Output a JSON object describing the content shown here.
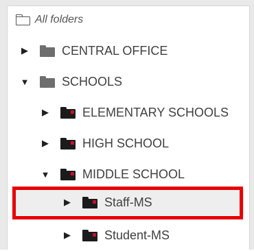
{
  "tree": {
    "root": {
      "label": "All folders",
      "icon": "folder-outline-icon"
    },
    "items": [
      {
        "label": "CENTRAL OFFICE",
        "caret": "▶",
        "icon": "folder-icon"
      },
      {
        "label": "SCHOOLS",
        "caret": "▼",
        "icon": "folder-icon"
      },
      {
        "label": "ELEMENTARY SCHOOLS",
        "caret": "▶",
        "icon": "folder-shared-icon"
      },
      {
        "label": "HIGH SCHOOL",
        "caret": "▶",
        "icon": "folder-shared-icon"
      },
      {
        "label": "MIDDLE SCHOOL",
        "caret": "▼",
        "icon": "folder-shared-icon"
      },
      {
        "label": "Staff-MS",
        "caret": "▶",
        "icon": "folder-shared-icon",
        "selected": true
      },
      {
        "label": "Student-MS",
        "caret": "▶",
        "icon": "folder-shared-icon"
      }
    ]
  },
  "colors": {
    "highlight_border": "#e60000",
    "selected_background": "#eeeeee",
    "folder_grey": "#6e6e6e",
    "folder_dark": "#1b1b1b",
    "shared_dot": "#c8102e"
  }
}
